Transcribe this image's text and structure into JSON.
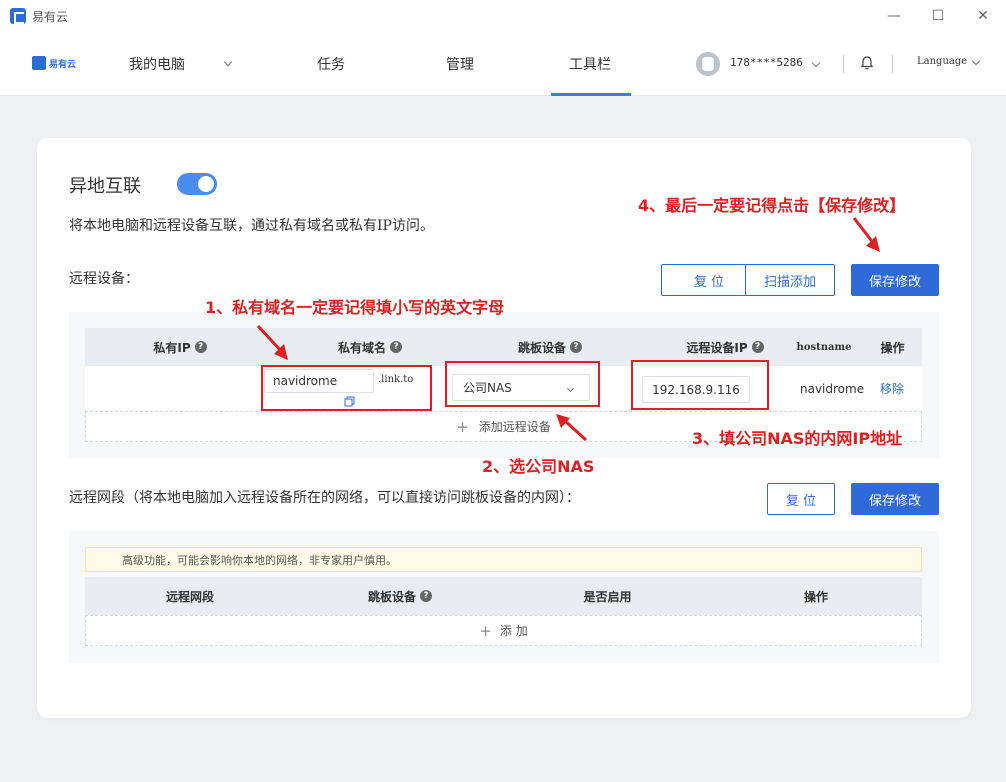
{
  "titlebar": {
    "app_name": "易有云"
  },
  "nav": {
    "brand_text": "易有云",
    "my_computer": "我的电脑",
    "tasks": "任务",
    "manage": "管理",
    "toolbar": "工具栏",
    "phone": "178****5286",
    "language": "Language"
  },
  "main": {
    "title": "异地互联",
    "toggle_on": true,
    "description": "将本地电脑和远程设备互联，通过私有域名或私有IP访问。",
    "remote_devices": {
      "title": "远程设备：",
      "reset_label": "复 位",
      "scan_add_label": "扫描添加",
      "save_label": "保存修改",
      "columns": {
        "private_ip": "私有IP",
        "private_domain": "私有域名",
        "jump_device": "跳板设备",
        "remote_ip": "远程设备IP",
        "hostname": "hostname",
        "action": "操作"
      },
      "row": {
        "domain_value": "navidrome",
        "domain_suffix": ".link.to",
        "jump_device": "公司NAS",
        "remote_ip": "192.168.9.116",
        "hostname": "navidrome",
        "remove": "移除"
      },
      "add_label": "添加远程设备"
    },
    "remote_subnet": {
      "title": "远程网段（将本地电脑加入远程设备所在的网络，可以直接访问跳板设备的内网）：",
      "reset_label": "复 位",
      "save_label": "保存修改",
      "warning": "高级功能，可能会影响你本地的网络，非专家用户慎用。",
      "columns": {
        "subnet": "远程网段",
        "jump_device": "跳板设备",
        "enabled": "是否启用",
        "action": "操作"
      },
      "add_label": "添 加"
    }
  },
  "annotations": {
    "a1": "1、私有域名一定要记得填小写的英文字母",
    "a2": "2、选公司NAS",
    "a3": "3、填公司NAS的内网IP地址",
    "a4": "4、最后一定要记得点击【保存修改】"
  },
  "colors": {
    "accent": "#2f6bd8",
    "annotation": "#e02020"
  }
}
